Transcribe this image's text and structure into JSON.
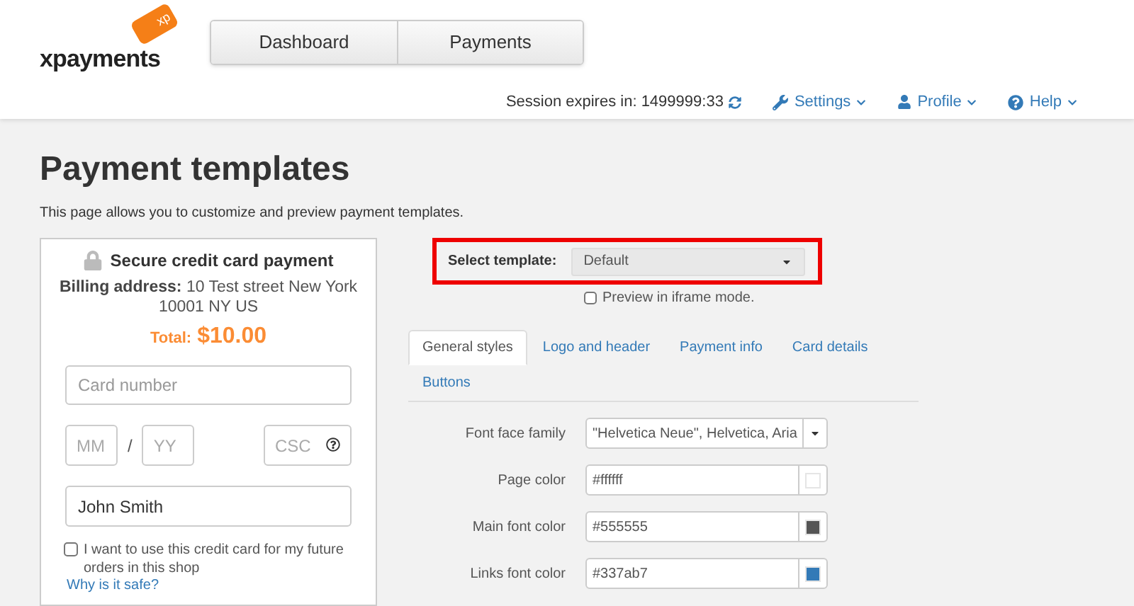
{
  "logo": {
    "text": "xpayments",
    "badge": "xp"
  },
  "nav": [
    {
      "label": "Dashboard",
      "selected": false
    },
    {
      "label": "Payments",
      "selected": false
    }
  ],
  "session": {
    "label": "Session expires in: 1499999:33"
  },
  "menus": [
    {
      "label": "Settings",
      "kind": "settings"
    },
    {
      "label": "Profile",
      "kind": "profile"
    },
    {
      "label": "Help",
      "kind": "help"
    }
  ],
  "page": {
    "title": "Payment templates",
    "description": "This page allows you to customize and preview payment templates."
  },
  "preview": {
    "title": "Secure credit card payment",
    "billing_label": "Billing address:",
    "billing_value": "10 Test street New York 10001 NY US",
    "total_label": "Total:",
    "total_value": "$10.00",
    "card_number": {
      "placeholder": "Card number"
    },
    "month": {
      "placeholder": "MM"
    },
    "separator": "/",
    "year": {
      "placeholder": "YY"
    },
    "csc": {
      "placeholder": "CSC"
    },
    "name": {
      "value": "John Smith"
    },
    "save_card": {
      "label": "I want to use this credit card for my future orders in this shop",
      "checked": false
    },
    "safe_link": "Why is it safe?"
  },
  "template": {
    "label": "Select template:",
    "value": "Default",
    "iframe": {
      "label": "Preview in iframe mode.",
      "checked": false
    }
  },
  "tabs": [
    {
      "label": "General styles",
      "selected": true
    },
    {
      "label": "Logo and header",
      "selected": false
    },
    {
      "label": "Payment info",
      "selected": false
    },
    {
      "label": "Card details",
      "selected": false
    },
    {
      "label": "Buttons",
      "selected": false
    }
  ],
  "fields": [
    {
      "label": "Font face family",
      "kind": "select",
      "value": "\"Helvetica Neue\", Helvetica, Aria"
    },
    {
      "label": "Page color",
      "kind": "color",
      "value": "#ffffff",
      "color": "#ffffff"
    },
    {
      "label": "Main font color",
      "kind": "color",
      "value": "#555555",
      "color": "#555555"
    },
    {
      "label": "Links font color",
      "kind": "color",
      "value": "#337ab7",
      "color": "#337ab7"
    }
  ]
}
